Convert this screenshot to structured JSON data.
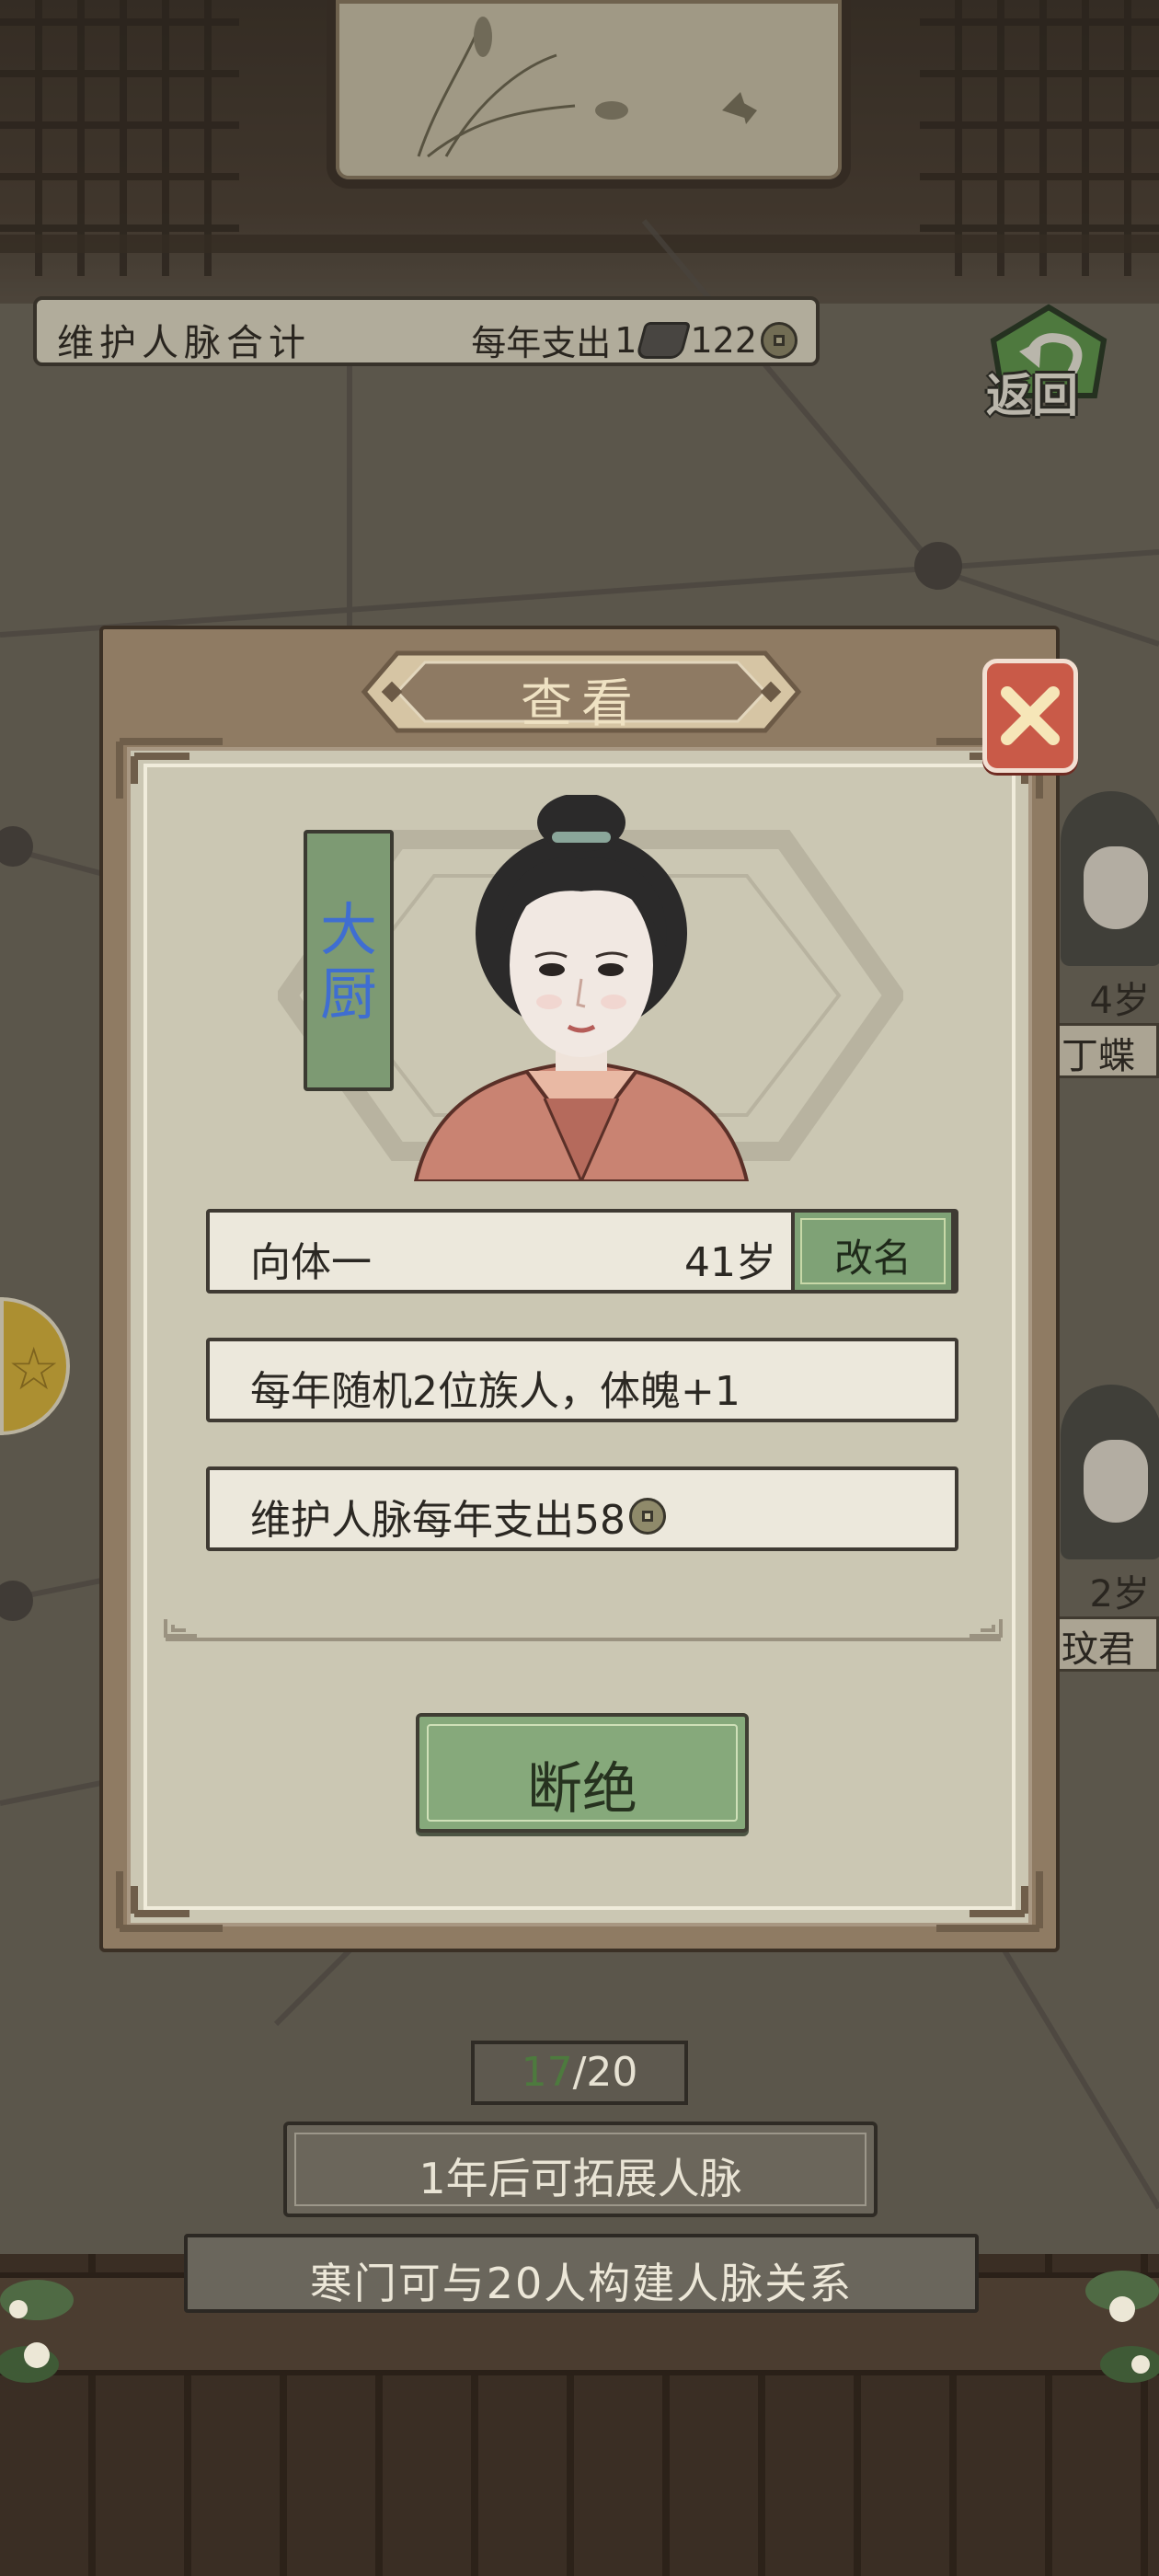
{
  "header": {
    "summary_label": "维护人脉合计",
    "yearly_cost_prefix": "每年支出",
    "cost_ingot_amount": "1",
    "cost_coin_amount": "122",
    "back_label": "返回"
  },
  "side_cards": [
    {
      "age": "4岁",
      "name": "丁蝶"
    },
    {
      "age": "2岁",
      "name": "玟君"
    }
  ],
  "modal": {
    "title": "查看",
    "job_tag": "大厨",
    "person": {
      "name": "向体一",
      "age": "41岁",
      "rename_label": "改名"
    },
    "effect_text": "每年随机2位族人，体魄+1",
    "upkeep_text": "维护人脉每年支出58",
    "sever_label": "断绝"
  },
  "footer": {
    "count_current": "17",
    "count_separator": "/",
    "count_max": "20",
    "expand_text": "1年后可拓展人脉",
    "capacity_text": "寒门可与20人构建人脉关系"
  },
  "colors": {
    "accent_green": "#7fa276",
    "close_red": "#c95a48",
    "job_text_blue": "#3f6ed1",
    "panel_brown": "#8f7b63",
    "panel_inner": "#cbc7b3"
  }
}
